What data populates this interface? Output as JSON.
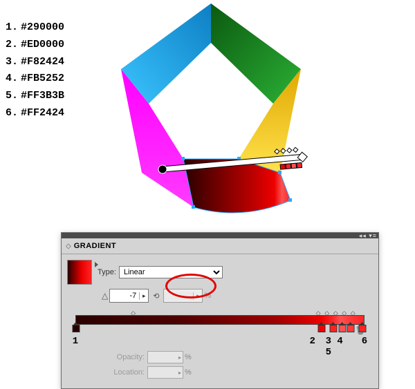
{
  "color_list": [
    {
      "num": "1.",
      "hex": "#290000"
    },
    {
      "num": "2.",
      "hex": "#ED0000"
    },
    {
      "num": "3.",
      "hex": "#F82424"
    },
    {
      "num": "4.",
      "hex": "#FB5252"
    },
    {
      "num": "5.",
      "hex": "#FF3B3B"
    },
    {
      "num": "6.",
      "hex": "#FF2424"
    }
  ],
  "illustration": {
    "segments": {
      "top_right": "#178a1f",
      "right": "#f5c400",
      "bottom_right": "#e52020",
      "bottom_left": "#ff00ff",
      "left": "#1a9fe0"
    },
    "gradient_tool_angle_deg": -7,
    "selection_color": "#2aa9ff"
  },
  "panel": {
    "title": "GRADIENT",
    "flyout_glyph": "◂◂ ▾≡",
    "type_label": "Type:",
    "type_value": "Linear",
    "angle_icon": "△",
    "angle_value": "-7",
    "ratio_icon": "⟲",
    "ratio_value": "",
    "ratio_suffix": "%",
    "diamond_midpoints": [
      20,
      84,
      87,
      90,
      93,
      96
    ],
    "opacity_label": "Opacity:",
    "opacity_value": "",
    "opacity_suffix": "%",
    "location_label": "Location:",
    "location_value": "",
    "location_suffix": "%",
    "gradient_stops": [
      {
        "id": "1",
        "pos_pct": 0,
        "color": "#290000"
      },
      {
        "id": "2",
        "pos_pct": 85,
        "color": "#ED0000"
      },
      {
        "id": "3",
        "pos_pct": 89,
        "color": "#F82424"
      },
      {
        "id": "4",
        "pos_pct": 92,
        "color": "#FB5252"
      },
      {
        "id": "5",
        "pos_pct": 95,
        "color": "#FF3B3B"
      },
      {
        "id": "6",
        "pos_pct": 99,
        "color": "#FF2424"
      }
    ],
    "stop_number_labels": [
      {
        "text": "1",
        "pos_pct": 0
      },
      {
        "text": "2",
        "pos_pct": 82
      },
      {
        "text": "3 4 5",
        "pos_pct": 91
      },
      {
        "text": "6",
        "pos_pct": 100
      }
    ]
  }
}
